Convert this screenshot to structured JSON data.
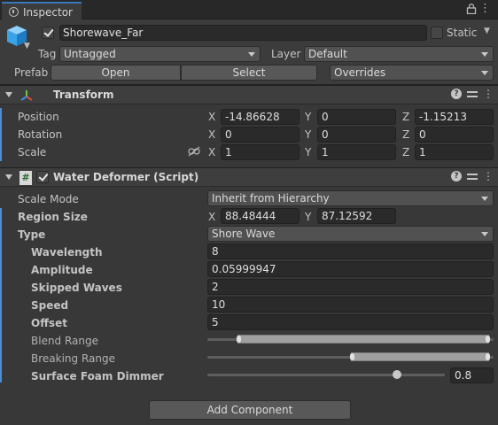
{
  "window": {
    "tab_label": "Inspector",
    "tab_icon": "info-icon",
    "lock_icon": "lock-icon",
    "menu_icon": "menu-icon",
    "menu_glyph": "⋮"
  },
  "gameobject": {
    "icon": "cube-icon",
    "active": true,
    "name": "Shorewave_Far",
    "static_label": "Static",
    "static_checked": false,
    "tag_label": "Tag",
    "tag_value": "Untagged",
    "layer_label": "Layer",
    "layer_value": "Default",
    "prefab_label": "Prefab",
    "prefab_open": "Open",
    "prefab_select": "Select",
    "prefab_overrides": "Overrides"
  },
  "transform": {
    "title": "Transform",
    "icon": "transform-axes-icon",
    "help_glyph": "?",
    "more_glyph": "⋮",
    "axis_x": "X",
    "axis_y": "Y",
    "axis_z": "Z",
    "position": {
      "label": "Position",
      "x": "-14.86628",
      "y": "0",
      "z": "-1.15213"
    },
    "rotation": {
      "label": "Rotation",
      "x": "0",
      "y": "0",
      "z": "0"
    },
    "scale": {
      "label": "Scale",
      "x": "1",
      "y": "1",
      "z": "1",
      "link_icon": "constrain-proportions-icon"
    }
  },
  "water_deformer": {
    "title": "Water Deformer (Script)",
    "icon": "csharp-script-icon",
    "icon_glyph": "#",
    "enabled": true,
    "scale_mode": {
      "label": "Scale Mode",
      "value": "Inherit from Hierarchy"
    },
    "region_size": {
      "label": "Region Size",
      "x_label": "X",
      "y_label": "Y",
      "x": "88.48444",
      "y": "87.12592"
    },
    "type": {
      "label": "Type",
      "value": "Shore Wave"
    },
    "wavelength": {
      "label": "Wavelength",
      "value": "8"
    },
    "amplitude": {
      "label": "Amplitude",
      "value": "0.05999947"
    },
    "skipped_waves": {
      "label": "Skipped Waves",
      "value": "2"
    },
    "speed": {
      "label": "Speed",
      "value": "10"
    },
    "offset": {
      "label": "Offset",
      "value": "5"
    },
    "blend_range": {
      "label": "Blend Range",
      "min": 0.1,
      "max": 0.99
    },
    "breaking_range": {
      "label": "Breaking Range",
      "min": 0.5,
      "max": 0.99
    },
    "surface_foam_dimmer": {
      "label": "Surface Foam Dimmer",
      "value": "0.8",
      "fraction": 0.8
    }
  },
  "add_component": "Add Component",
  "colors": {
    "accent": "#3a79bb",
    "override_marker": "#4b8ed4",
    "panel_bg": "#383838",
    "field_bg": "#2a2a2a"
  }
}
